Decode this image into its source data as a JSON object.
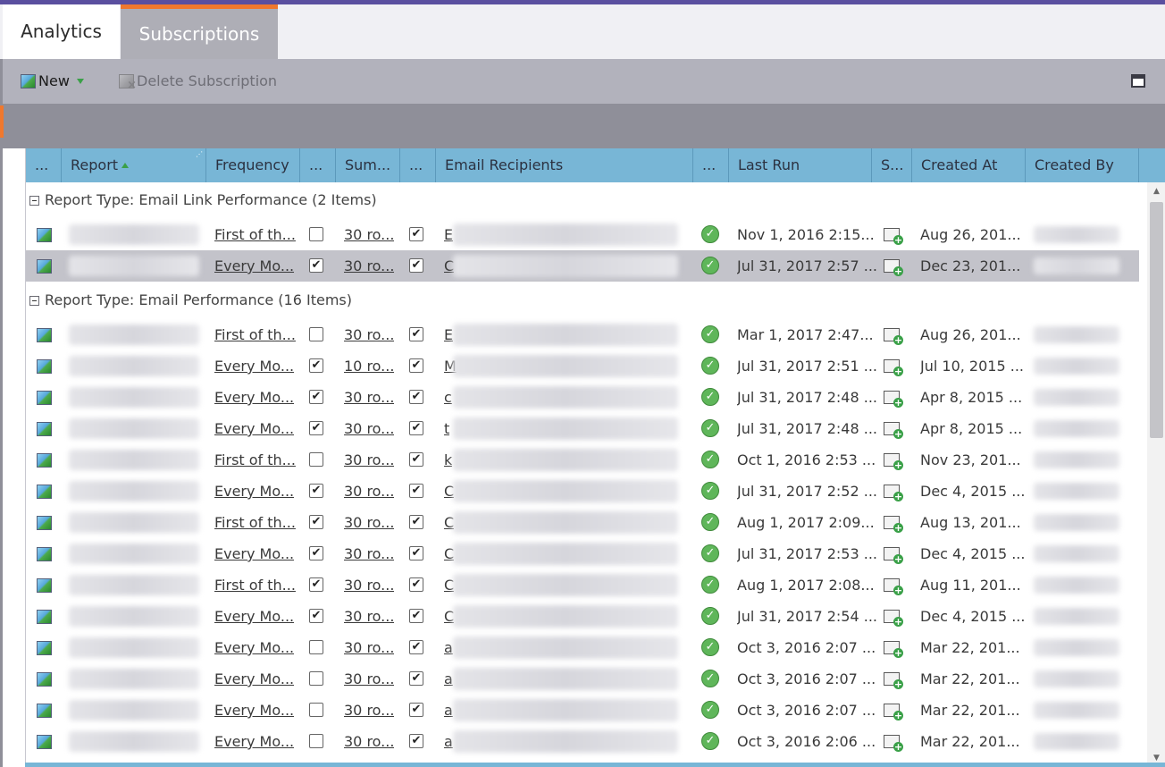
{
  "tabs": [
    {
      "label": "Analytics"
    },
    {
      "label": "Subscriptions"
    }
  ],
  "toolbar": {
    "new_label": "New",
    "delete_label": "Delete Subscription"
  },
  "columns": [
    "...",
    "Report",
    "Frequency",
    "...",
    "Sum...",
    "...",
    "Email Recipients",
    "...",
    "Last Run",
    "S...",
    "Created At",
    "Created By"
  ],
  "groups": [
    {
      "label": "Report Type: Email Link Performance (2 Items)"
    },
    {
      "label": "Report Type: Email Performance (16 Items)"
    }
  ],
  "rows": [
    {
      "group": 0,
      "frequency": "First of th...",
      "summary_checked": false,
      "summary": "30 ro...",
      "attach_checked": true,
      "email_initial": "E",
      "last_run": "Nov 1, 2016 2:15...",
      "created_at": "Aug 26, 201...",
      "selected": false
    },
    {
      "group": 0,
      "frequency": "Every Mo...",
      "summary_checked": true,
      "summary": "30 ro...",
      "attach_checked": true,
      "email_initial": "C",
      "last_run": "Jul 31, 2017 2:57 ...",
      "created_at": "Dec 23, 201...",
      "selected": true
    },
    {
      "group": 1,
      "frequency": "First of th...",
      "summary_checked": false,
      "summary": "30 ro...",
      "attach_checked": true,
      "email_initial": "E",
      "last_run": "Mar 1, 2017 2:47...",
      "created_at": "Aug 26, 201...",
      "selected": false
    },
    {
      "group": 1,
      "frequency": "Every Mo...",
      "summary_checked": true,
      "summary": "10 ro...",
      "attach_checked": true,
      "email_initial": "M",
      "last_run": "Jul 31, 2017 2:51 ...",
      "created_at": "Jul 10, 2015 ...",
      "selected": false
    },
    {
      "group": 1,
      "frequency": "Every Mo...",
      "summary_checked": true,
      "summary": "30 ro...",
      "attach_checked": true,
      "email_initial": "c",
      "last_run": "Jul 31, 2017 2:48 ...",
      "created_at": "Apr 8, 2015 ...",
      "selected": false
    },
    {
      "group": 1,
      "frequency": "Every Mo...",
      "summary_checked": true,
      "summary": "30 ro...",
      "attach_checked": true,
      "email_initial": "t",
      "last_run": "Jul 31, 2017 2:48 ...",
      "created_at": "Apr 8, 2015 ...",
      "selected": false
    },
    {
      "group": 1,
      "frequency": "First of th...",
      "summary_checked": false,
      "summary": "30 ro...",
      "attach_checked": true,
      "email_initial": "k",
      "last_run": "Oct 1, 2016 2:53 ...",
      "created_at": "Nov 23, 201...",
      "selected": false
    },
    {
      "group": 1,
      "frequency": "Every Mo...",
      "summary_checked": true,
      "summary": "30 ro...",
      "attach_checked": true,
      "email_initial": "C",
      "last_run": "Jul 31, 2017 2:52 ...",
      "created_at": "Dec 4, 2015 ...",
      "selected": false
    },
    {
      "group": 1,
      "frequency": "First of th...",
      "summary_checked": true,
      "summary": "30 ro...",
      "attach_checked": true,
      "email_initial": "C",
      "last_run": "Aug 1, 2017 2:09...",
      "created_at": "Aug 13, 201...",
      "selected": false
    },
    {
      "group": 1,
      "frequency": "Every Mo...",
      "summary_checked": true,
      "summary": "30 ro...",
      "attach_checked": true,
      "email_initial": "C",
      "last_run": "Jul 31, 2017 2:53 ...",
      "created_at": "Dec 4, 2015 ...",
      "selected": false
    },
    {
      "group": 1,
      "frequency": "First of th...",
      "summary_checked": true,
      "summary": "30 ro...",
      "attach_checked": true,
      "email_initial": "C",
      "last_run": "Aug 1, 2017 2:08...",
      "created_at": "Aug 11, 201...",
      "selected": false
    },
    {
      "group": 1,
      "frequency": "Every Mo...",
      "summary_checked": true,
      "summary": "30 ro...",
      "attach_checked": true,
      "email_initial": "C",
      "last_run": "Jul 31, 2017 2:54 ...",
      "created_at": "Dec 4, 2015 ...",
      "selected": false
    },
    {
      "group": 1,
      "frequency": "Every Mo...",
      "summary_checked": false,
      "summary": "30 ro...",
      "attach_checked": true,
      "email_initial": "a",
      "last_run": "Oct 3, 2016 2:07 ...",
      "created_at": "Mar 22, 201...",
      "selected": false
    },
    {
      "group": 1,
      "frequency": "Every Mo...",
      "summary_checked": false,
      "summary": "30 ro...",
      "attach_checked": true,
      "email_initial": "a",
      "last_run": "Oct 3, 2016 2:07 ...",
      "created_at": "Mar 22, 201...",
      "selected": false
    },
    {
      "group": 1,
      "frequency": "Every Mo...",
      "summary_checked": false,
      "summary": "30 ro...",
      "attach_checked": true,
      "email_initial": "a",
      "last_run": "Oct 3, 2016 2:07 ...",
      "created_at": "Mar 22, 201...",
      "selected": false
    },
    {
      "group": 1,
      "frequency": "Every Mo...",
      "summary_checked": false,
      "summary": "30 ro...",
      "attach_checked": true,
      "email_initial": "a",
      "last_run": "Oct 3, 2016 2:06 ...",
      "created_at": "Mar 22, 201...",
      "selected": false
    }
  ],
  "icons": {
    "report": "report-icon",
    "new": "new-report-icon",
    "delete": "delete-subscription-icon",
    "status": "success-check-icon",
    "schedule": "add-schedule-icon",
    "window": "maximize-window-icon",
    "sort": "sort-ascending-icon"
  },
  "colors": {
    "top_accent": "#5a4f9f",
    "active_tab_accent": "#f0782d",
    "header_bg": "#78b6d6",
    "toolbar_bg": "#b2b2bc",
    "selected_row": "#c3c3ca"
  }
}
